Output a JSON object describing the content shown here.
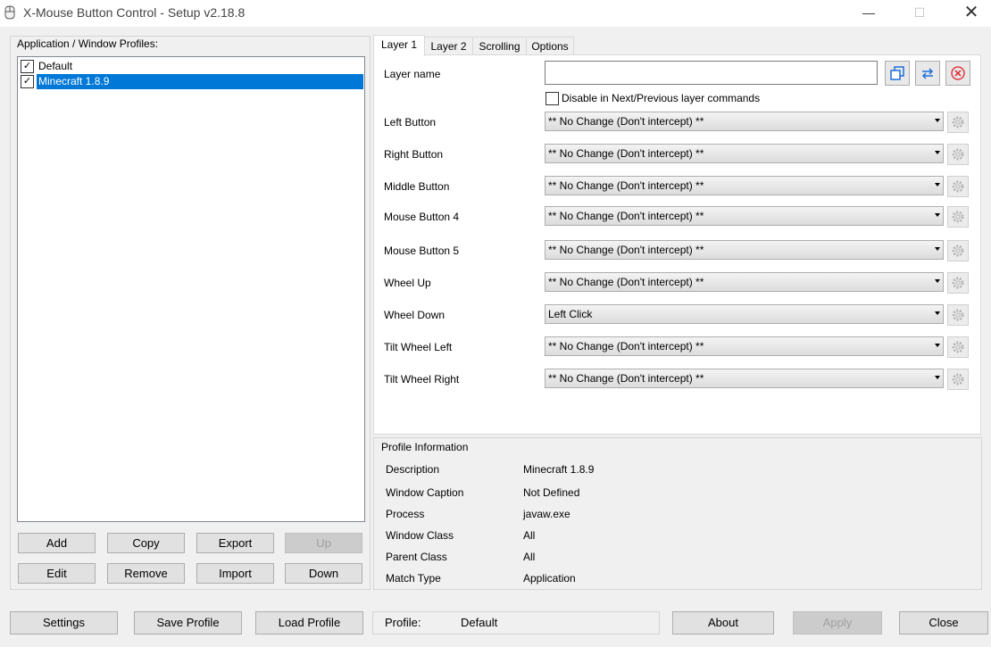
{
  "window": {
    "title": "X-Mouse Button Control - Setup v2.18.8",
    "minimize": "—",
    "maximize": "☐",
    "close": "✕"
  },
  "profiles": {
    "label": "Application / Window Profiles:",
    "items": [
      {
        "label": "Default",
        "checked": true,
        "selected": false
      },
      {
        "label": "Minecraft 1.8.9",
        "checked": true,
        "selected": true
      }
    ],
    "buttons": {
      "add": "Add",
      "copy": "Copy",
      "export": "Export",
      "up": "Up",
      "edit": "Edit",
      "remove": "Remove",
      "import": "Import",
      "down": "Down"
    }
  },
  "tabs": [
    "Layer 1",
    "Layer 2",
    "Scrolling",
    "Options"
  ],
  "layer": {
    "name_label": "Layer name",
    "name_value": "",
    "disable_label": "Disable in Next/Previous layer commands",
    "rows": [
      {
        "label": "Left Button",
        "value": "** No Change (Don't intercept) **"
      },
      {
        "label": "Right Button",
        "value": "** No Change (Don't intercept) **"
      },
      {
        "label": "Middle Button",
        "value": "** No Change (Don't intercept) **"
      },
      {
        "label": "Mouse Button 4",
        "value": "** No Change (Don't intercept) **"
      },
      {
        "label": "Mouse Button 5",
        "value": "** No Change (Don't intercept) **"
      },
      {
        "label": "Wheel Up",
        "value": "** No Change (Don't intercept) **"
      },
      {
        "label": "Wheel Down",
        "value": "Left Click"
      },
      {
        "label": "Tilt Wheel Left",
        "value": "** No Change (Don't intercept) **"
      },
      {
        "label": "Tilt Wheel Right",
        "value": "** No Change (Don't intercept) **"
      }
    ]
  },
  "profile_info": {
    "title": "Profile Information",
    "fields": [
      {
        "label": "Description",
        "value": "Minecraft 1.8.9"
      },
      {
        "label": "Window Caption",
        "value": "Not Defined"
      },
      {
        "label": "Process",
        "value": "javaw.exe"
      },
      {
        "label": "Window Class",
        "value": "All"
      },
      {
        "label": "Parent Class",
        "value": "All"
      },
      {
        "label": "Match Type",
        "value": "Application"
      }
    ]
  },
  "bottom": {
    "settings": "Settings",
    "save_profile": "Save Profile",
    "load_profile": "Load Profile",
    "profile_label": "Profile:",
    "profile_value": "Default",
    "about": "About",
    "apply": "Apply",
    "close": "Close"
  },
  "colors": {
    "selection": "#0078d7",
    "window_bg": "#f0f0f0",
    "copy_icon": "#1e6fd9",
    "swap_icon": "#1e6fd9",
    "delete_icon": "#e0202a"
  }
}
